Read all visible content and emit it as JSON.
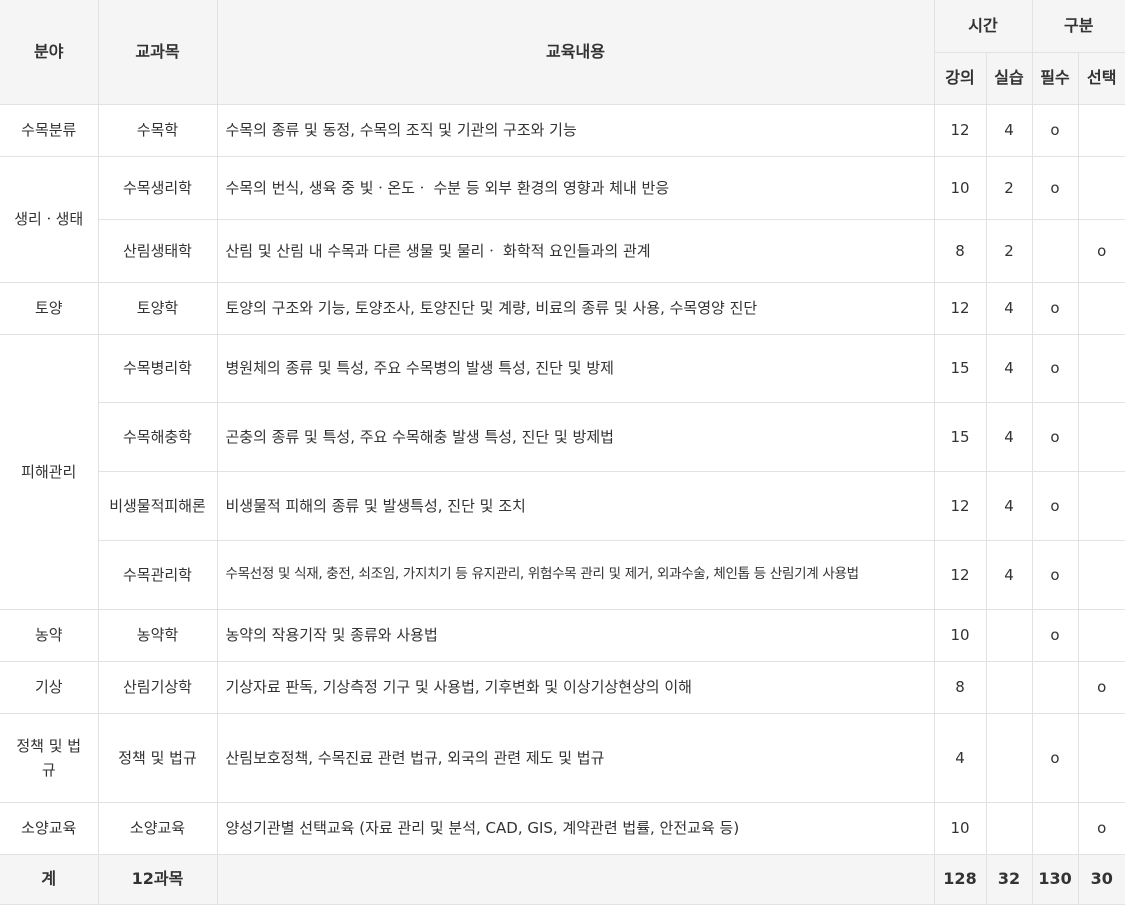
{
  "header": {
    "field": "분야",
    "subject": "교과목",
    "content": "교육내용",
    "time": "시간",
    "category": "구분",
    "lecture": "강의",
    "practice": "실습",
    "required": "필수",
    "elective": "선택"
  },
  "rows": [
    {
      "field": "수목분류",
      "subject": "수목학",
      "content": "수목의 종류 및 동정, 수목의 조직 및 기관의 구조와 기능",
      "lecture": "12",
      "practice": "4",
      "required": "o",
      "elective": ""
    },
    {
      "field": "생리ㆍ생태",
      "subject": "수목생리학",
      "content": "수목의 번식, 생육 중 빛ㆍ온도ㆍ 수분 등 외부 환경의 영향과 체내 반응",
      "lecture": "10",
      "practice": "2",
      "required": "o",
      "elective": ""
    },
    {
      "field": "",
      "subject": "산림생태학",
      "content": "산림 및 산림 내 수목과 다른 생물 및 물리ㆍ 화학적 요인들과의 관계",
      "lecture": "8",
      "practice": "2",
      "required": "",
      "elective": "o"
    },
    {
      "field": "토양",
      "subject": "토양학",
      "content": "토양의 구조와 기능, 토양조사, 토양진단 및 계량, 비료의 종류 및 사용, 수목영양 진단",
      "lecture": "12",
      "practice": "4",
      "required": "o",
      "elective": ""
    },
    {
      "field": "피해관리",
      "subject": "수목병리학",
      "content": "병원체의 종류 및 특성, 주요 수목병의 발생 특성, 진단 및 방제",
      "lecture": "15",
      "practice": "4",
      "required": "o",
      "elective": ""
    },
    {
      "field": "",
      "subject": "수목해충학",
      "content": "곤충의 종류 및 특성, 주요 수목해충 발생 특성, 진단 및 방제법",
      "lecture": "15",
      "practice": "4",
      "required": "o",
      "elective": ""
    },
    {
      "field": "",
      "subject": "비생물적피해론",
      "content": "비생물적 피해의 종류 및 발생특성, 진단 및 조치",
      "lecture": "12",
      "practice": "4",
      "required": "o",
      "elective": ""
    },
    {
      "field": "",
      "subject": "수목관리학",
      "content": "수목선정 및 식재, 충전, 쇠조임, 가지치기 등 유지관리, 위험수목 관리 및 제거, 외과수술, 체인톱 등 산림기계 사용법",
      "lecture": "12",
      "practice": "4",
      "required": "o",
      "elective": ""
    },
    {
      "field": "농약",
      "subject": "농약학",
      "content": "농약의 작용기작 및 종류와 사용법",
      "lecture": "10",
      "practice": "",
      "required": "o",
      "elective": ""
    },
    {
      "field": "기상",
      "subject": "산림기상학",
      "content": "기상자료 판독, 기상측정 기구 및 사용법, 기후변화 및 이상기상현상의 이해",
      "lecture": "8",
      "practice": "",
      "required": "",
      "elective": "o"
    },
    {
      "field": "정책 및 법규",
      "subject": "정책 및 법규",
      "content": "산림보호정책, 수목진료 관련 법규, 외국의 관련 제도 및 법규",
      "lecture": "4",
      "practice": "",
      "required": "o",
      "elective": ""
    },
    {
      "field": "소양교육",
      "subject": "소양교육",
      "content": "양성기관별 선택교육 (자료 관리 및 분석, CAD, GIS, 계약관련 법률, 안전교육 등)",
      "lecture": "10",
      "practice": "",
      "required": "",
      "elective": "o"
    }
  ],
  "total": {
    "label": "계",
    "subjects": "12과목",
    "lecture": "128",
    "practice": "32",
    "required": "130",
    "elective": "30"
  }
}
